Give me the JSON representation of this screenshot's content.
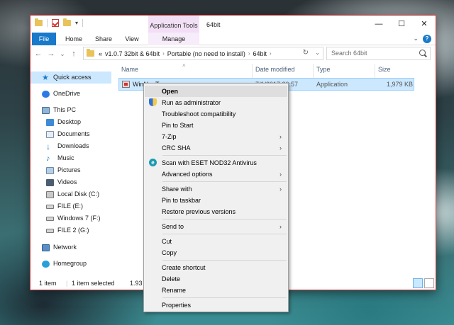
{
  "window": {
    "title": "64bit",
    "tool_tab": "Application Tools",
    "controls": {
      "minimize": "—",
      "maximize": "☐",
      "close": "✕"
    }
  },
  "ribbon": {
    "tabs": [
      "File",
      "Home",
      "Share",
      "View",
      "Manage"
    ],
    "help": "?",
    "collapse": "⌄"
  },
  "navbar": {
    "back": "←",
    "forward": "→",
    "recent": "⌄",
    "up": "↑",
    "breadcrumb": [
      "v1.0.7 32bit & 64bit",
      "Portable (no need to install)",
      "64bit"
    ],
    "overflow": "«",
    "search_placeholder": "Search 64bit"
  },
  "sidebar": {
    "items": [
      {
        "label": "Quick access",
        "icon": "star-icon"
      },
      {
        "label": "OneDrive",
        "icon": "cloud-icon"
      },
      {
        "label": "This PC",
        "icon": "computer-icon"
      },
      {
        "label": "Desktop",
        "icon": "desktop-folder-icon"
      },
      {
        "label": "Documents",
        "icon": "documents-folder-icon"
      },
      {
        "label": "Downloads",
        "icon": "downloads-folder-icon"
      },
      {
        "label": "Music",
        "icon": "music-folder-icon"
      },
      {
        "label": "Pictures",
        "icon": "pictures-folder-icon"
      },
      {
        "label": "Videos",
        "icon": "videos-folder-icon"
      },
      {
        "label": "Local Disk (C:)",
        "icon": "windows-drive-icon"
      },
      {
        "label": "FILE (E:)",
        "icon": "drive-icon"
      },
      {
        "label": "Windows 7 (F:)",
        "icon": "drive-icon"
      },
      {
        "label": "FILE 2 (G:)",
        "icon": "drive-icon"
      },
      {
        "label": "Network",
        "icon": "network-icon"
      },
      {
        "label": "Homegroup",
        "icon": "homegroup-icon"
      }
    ]
  },
  "columns": [
    "Name",
    "Date modified",
    "Type",
    "Size"
  ],
  "files": [
    {
      "name": "WinNonT...",
      "date": "7/1/2017 20:57",
      "type": "Application",
      "size": "1,979 KB"
    }
  ],
  "status": {
    "count": "1 item",
    "selected": "1 item selected",
    "size": "1.93 MB"
  },
  "context_menu": {
    "items": [
      {
        "label": "Open",
        "bold": true
      },
      {
        "label": "Run as administrator",
        "icon": "shield-icon"
      },
      {
        "label": "Troubleshoot compatibility"
      },
      {
        "label": "Pin to Start"
      },
      {
        "label": "7-Zip",
        "submenu": true
      },
      {
        "label": "CRC SHA",
        "submenu": true
      },
      {
        "label": "Scan with ESET NOD32 Antivirus",
        "icon": "eset-icon"
      },
      {
        "label": "Advanced options",
        "submenu": true
      },
      {
        "label": "Share with",
        "submenu": true
      },
      {
        "label": "Pin to taskbar"
      },
      {
        "label": "Restore previous versions"
      },
      {
        "label": "Send to",
        "submenu": true
      },
      {
        "label": "Cut"
      },
      {
        "label": "Copy"
      },
      {
        "label": "Create shortcut"
      },
      {
        "label": "Delete"
      },
      {
        "label": "Rename"
      },
      {
        "label": "Properties"
      }
    ],
    "submenu_arrow": "›"
  },
  "colors": {
    "accent": "#1979ca",
    "selection": "#cce8ff",
    "tool_tab": "#f2dff5",
    "window_border": "#e3373a"
  }
}
